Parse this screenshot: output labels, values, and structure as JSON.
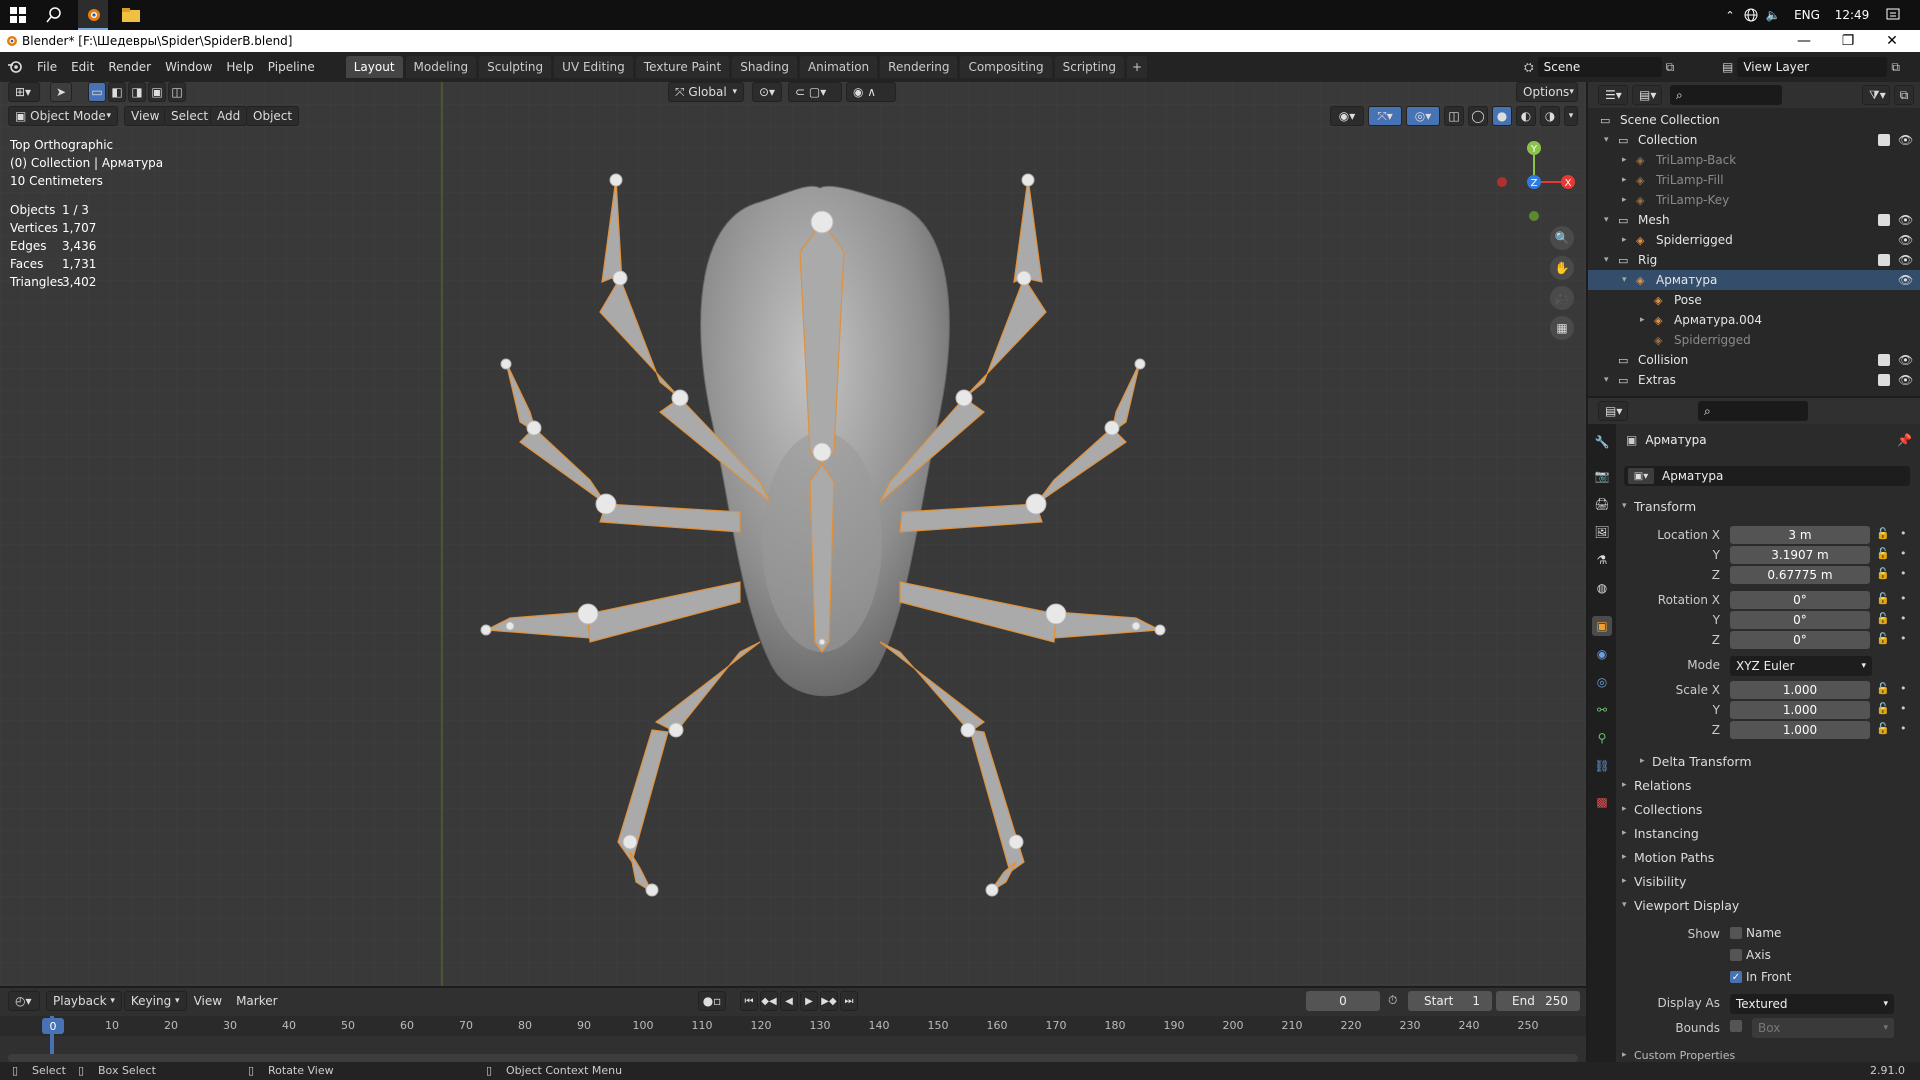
{
  "taskbar": {
    "lang": "ENG",
    "time": "12:49"
  },
  "window": {
    "title": "Blender* [F:\\Шедевры\\Spider\\SpiderB.blend]"
  },
  "menubar": {
    "items": [
      "File",
      "Edit",
      "Render",
      "Window",
      "Help",
      "Pipeline"
    ]
  },
  "workspaces": [
    "Layout",
    "Modeling",
    "Sculpting",
    "UV Editing",
    "Texture Paint",
    "Shading",
    "Animation",
    "Rendering",
    "Compositing",
    "Scripting"
  ],
  "workspace_add": "+",
  "scene": "Scene",
  "view_layer": "View Layer",
  "viewport": {
    "orientation": "Global",
    "options_label": "Options",
    "mode": "Object Mode",
    "menus": [
      "View",
      "Select",
      "Add",
      "Object"
    ],
    "view_name": "Top Orthographic",
    "collection_info": "(0) Collection | Арматура",
    "scale": "10 Centimeters",
    "stats": [
      {
        "label": "Objects",
        "value": "1 / 3"
      },
      {
        "label": "Vertices",
        "value": "1,707"
      },
      {
        "label": "Edges",
        "value": "3,436"
      },
      {
        "label": "Faces",
        "value": "1,731"
      },
      {
        "label": "Triangles",
        "value": "3,402"
      }
    ],
    "gizmo": {
      "y": "Y",
      "z": "Z",
      "x": "X"
    }
  },
  "timeline": {
    "menus": [
      "Playback",
      "Keying",
      "View",
      "Marker"
    ],
    "current_frame": "0",
    "start_label": "Start",
    "start": "1",
    "end_label": "End",
    "end": "250",
    "ruler": [
      "0",
      "10",
      "20",
      "30",
      "40",
      "50",
      "60",
      "70",
      "80",
      "90",
      "100",
      "110",
      "120",
      "130",
      "140",
      "150",
      "160",
      "170",
      "180",
      "190",
      "200",
      "210",
      "220",
      "230",
      "240",
      "250"
    ]
  },
  "statusbar": {
    "select": "Select",
    "box_select": "Box Select",
    "rotate": "Rotate View",
    "context": "Object Context Menu",
    "version": "2.91.0"
  },
  "outliner": {
    "rows": [
      {
        "label": "Scene Collection",
        "depth": 0,
        "arrow": "",
        "check": false,
        "eye": false,
        "dim": false,
        "selected": false
      },
      {
        "label": "Collection",
        "depth": 1,
        "arrow": "▾",
        "check": true,
        "eye": true,
        "dim": false,
        "selected": false
      },
      {
        "label": "TriLamp-Back",
        "depth": 2,
        "arrow": "▸",
        "check": false,
        "eye": false,
        "dim": true,
        "selected": false
      },
      {
        "label": "TriLamp-Fill",
        "depth": 2,
        "arrow": "▸",
        "check": false,
        "eye": false,
        "dim": true,
        "selected": false
      },
      {
        "label": "TriLamp-Key",
        "depth": 2,
        "arrow": "▸",
        "check": false,
        "eye": false,
        "dim": true,
        "selected": false
      },
      {
        "label": "Mesh",
        "depth": 1,
        "arrow": "▾",
        "check": true,
        "eye": true,
        "dim": false,
        "selected": false
      },
      {
        "label": "Spiderrigged",
        "depth": 2,
        "arrow": "▸",
        "check": false,
        "eye": true,
        "dim": false,
        "selected": false
      },
      {
        "label": "Rig",
        "depth": 1,
        "arrow": "▾",
        "check": true,
        "eye": true,
        "dim": false,
        "selected": false
      },
      {
        "label": "Арматура",
        "depth": 2,
        "arrow": "▾",
        "check": false,
        "eye": true,
        "dim": false,
        "selected": true
      },
      {
        "label": "Pose",
        "depth": 3,
        "arrow": "",
        "check": false,
        "eye": false,
        "dim": false,
        "selected": false
      },
      {
        "label": "Арматура.004",
        "depth": 3,
        "arrow": "▸",
        "check": false,
        "eye": false,
        "dim": false,
        "selected": false
      },
      {
        "label": "Spiderrigged",
        "depth": 3,
        "arrow": "",
        "check": false,
        "eye": false,
        "dim": true,
        "selected": false
      },
      {
        "label": "Collision",
        "depth": 1,
        "arrow": "",
        "check": true,
        "eye": true,
        "dim": false,
        "selected": false
      },
      {
        "label": "Extras",
        "depth": 1,
        "arrow": "▾",
        "check": true,
        "eye": true,
        "dim": false,
        "selected": false
      }
    ]
  },
  "properties": {
    "object_name": "Арматура",
    "name_field": "Арматура",
    "transform_label": "Transform",
    "location": {
      "label": "Location X",
      "x": "3 m",
      "y": "3.1907 m",
      "z": "0.67775 m"
    },
    "rotation": {
      "label": "Rotation X",
      "x": "0°",
      "y": "0°",
      "z": "0°"
    },
    "mode_label": "Mode",
    "mode_value": "XYZ Euler",
    "scale": {
      "label": "Scale X",
      "x": "1.000",
      "y": "1.000",
      "z": "1.000"
    },
    "axis_y": "Y",
    "axis_z": "Z",
    "delta": "Delta Transform",
    "sections": [
      "Relations",
      "Collections",
      "Instancing",
      "Motion Paths",
      "Visibility"
    ],
    "viewport_display": "Viewport Display",
    "show_label": "Show",
    "show_name": "Name",
    "show_axis": "Axis",
    "show_infront": "In Front",
    "display_as_label": "Display As",
    "display_as": "Textured",
    "bounds_label": "Bounds",
    "bounds_value": "Box",
    "custom": "Custom Properties"
  }
}
